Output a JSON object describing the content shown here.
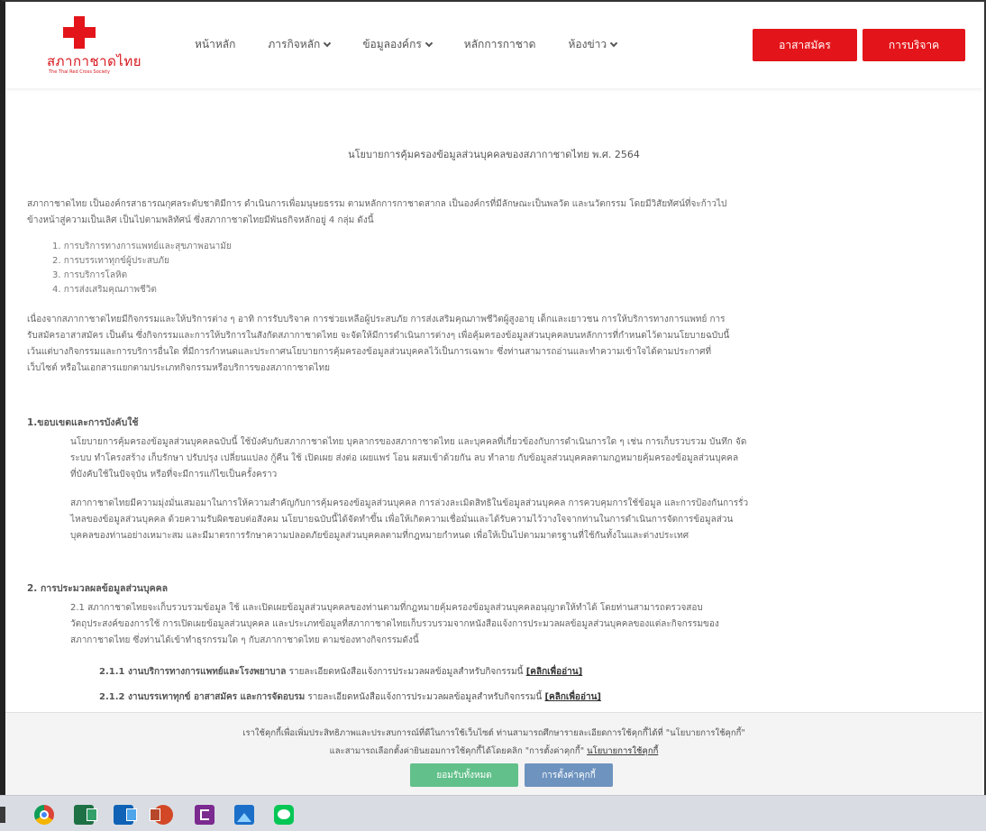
{
  "header": {
    "logo_thai": "สภากาชาดไทย",
    "logo_english": "The Thai Red Cross Society",
    "nav": [
      "หน้าหลัก",
      "ภารกิจหลัก",
      "ข้อมูลองค์กร",
      "หลักการกาชาด",
      "ห้องข่าว"
    ],
    "volunteer_button": "อาสาสมัคร",
    "donate_button": "การบริจาค"
  },
  "main": {
    "title": "นโยบายการคุ้มครองข้อมูลส่วนบุคคลของสภากาชาดไทย พ.ศ. 2564",
    "intro_lines": [
      "สภากาชาดไทย เป็นองค์กรสาธารณกุศลระดับชาติมีการ ดำเนินการเพื่อมนุษยธรรม ตามหลักการกาชาดสากล เป็นองค์กรที่มีลักษณะเป็นพลวัต และนวัตกรรม โดยมีวิสัยทัศน์ที่จะก้าวไป",
      "ข้างหน้าสู่ความเป็นเลิศ เป็นไปตามพลิทัศน์ ซึ่งสภากาชาดไทยมีพันธกิจหลักอยู่ 4 กลุ่ม ดังนี้"
    ],
    "missions": [
      "1. การบริการทางการแพทย์และสุขภาพอนามัย",
      "2. การบรรเทาทุกข์ผู้ประสบภัย",
      "3. การบริการโลหิต",
      "4. การส่งเสริมคุณภาพชีวิต"
    ],
    "para2_lines": [
      "เนื่องจากสภากาชาดไทยมีกิจกรรมและให้บริการต่าง ๆ อาทิ การรับบริจาค การช่วยเหลือผู้ประสบภัย การส่งเสริมคุณภาพชีวิตผู้สูงอายุ เด็กและเยาวชน การให้บริการทางการแพทย์ การ",
      "รับสมัครอาสาสมัคร เป็นต้น ซึ่งกิจกรรมและการให้บริการในสังกัดสภากาชาดไทย จะจัดให้มีการดำเนินการต่างๆ เพื่อคุ้มครองข้อมูลส่วนบุคคลบนหลักการที่กำหนดไว้ตามนโยบายฉบับนี้",
      "เว้นแต่บางกิจกรรมและการบริการอื่นใด ที่มีการกำหนดและประกาศนโยบายการคุ้มครองข้อมูลส่วนบุคคลไว้เป็นการเฉพาะ ซึ่งท่านสามารถอ่านและทำความเข้าใจได้ตามประกาศที่",
      "เว็บไซต์ หรือในเอกสารแยกตามประเภทกิจกรรมหรือบริการของสภากาชาดไทย"
    ],
    "section1_heading": "1.ขอบเขตและการบังคับใช้",
    "section1_p1_lines": [
      "นโยบายการคุ้มครองข้อมูลส่วนบุคคลฉบับนี้ ใช้บังคับกับสภากาชาดไทย บุคลากรของสภากาชาดไทย และบุคคลที่เกี่ยวข้องกับการดำเนินการใด ๆ เช่น การเก็บรวบรวม บันทึก จัด",
      "ระบบ ทำโครงสร้าง เก็บรักษา ปรับปรุง เปลี่ยนแปลง กู้คืน ใช้ เปิดเผย ส่งต่อ เผยแพร่ โอน ผสมเข้าด้วยกัน ลบ ทำลาย กับข้อมูลส่วนบุคคลตามกฎหมายคุ้มครองข้อมูลส่วนบุคคล",
      "ที่บังคับใช้ในปัจจุบัน หรือที่จะมีการแก้ไขเป็นครั้งคราว"
    ],
    "section1_p2_lines": [
      "สภากาชาดไทยมีความมุ่งมั่นเสมอมาในการให้ความสำคัญกับการคุ้มครองข้อมูลส่วนบุคคล การล่วงละเมิดสิทธิในข้อมูลส่วนบุคคล การควบคุมการใช้ข้อมูล และการป้องกันการรั่ว",
      "ไหลของข้อมูลส่วนบุคคล ด้วยความรับผิดชอบต่อสังคม นโยบายฉบับนี้ได้จัดทำขึ้น เพื่อให้เกิดความเชื่อมั่นและได้รับความไว้วางใจจากท่านในการดำเนินการจัดการข้อมูลส่วน",
      "บุคคลของท่านอย่างเหมาะสม และมีมาตรการรักษาความปลอดภัยข้อมูลส่วนบุคคลตามที่กฎหมายกำหนด เพื่อให้เป็นไปตามมาตรฐานที่ใช้กันทั้งในและต่างประเทศ"
    ],
    "section2_heading": "2. การประมวลผลข้อมูลส่วนบุคคล",
    "section2_p_lines": [
      "2.1 สภากาชาดไทยจะเก็บรวบรวมข้อมูล ใช้ และเปิดเผยข้อมูลส่วนบุคคลของท่านตามที่กฎหมายคุ้มครองข้อมูลส่วนบุคคลอนุญาตให้ทำได้ โดยท่านสามารถตรวจสอบ",
      "วัตถุประสงค์ของการใช้ การเปิดเผยข้อมูลส่วนบุคคล และประเภทข้อมูลที่สภากาชาดไทยเก็บรวบรวมจากหนังสือแจ้งการประมวลผลข้อมูลส่วนบุคคลของแต่ละกิจกรรมของ",
      "สภากาชาดไทย ซึ่งท่านได้เข้าทำธุรกรรมใด ๆ กับสภากาชาดไทย ตามช่องทางกิจกรรมดังนี้"
    ],
    "item_211_bold": "2.1.1 งานบริการทางการแพทย์และโรงพยาบาล",
    "item_211_text": " รายละเอียดหนังสือแจ้งการประมวลผลข้อมูลสำหรับกิจกรรมนี้ ",
    "item_211_link": "[คลิกเพื่ออ่าน]",
    "item_212_bold": "2.1.2 งานบรรเทาทุกข์ อาสาสมัคร และการจัดอบรม",
    "item_212_text": " รายละเอียดหนังสือแจ้งการประมวลผลข้อมูลสำหรับกิจกรรมนี้ ",
    "item_212_link": "[คลิกเพื่ออ่าน]"
  },
  "cookie": {
    "line1_text": "เราใช้คุกกี้เพื่อเพิ่มประสิทธิภาพและประสบการณ์ที่ดีในการใช้เว็บไซต์ ท่านสามารถศึกษารายละเอียดการใช้คุกกี้ได้ที่ \"นโยบายการใช้คุกกี้\"",
    "line2_text": "และสามารถเลือกตั้งค่ายินยอมการใช้คุกกี้ได้โดยคลิก \"การตั้งค่าคุกกี้\" ",
    "line2_link": "นโยบายการใช้คุกกี้",
    "accept_button": "ยอมรับทั้งหมด",
    "settings_button": "การตั้งค่าคุกกี้"
  },
  "taskbar": {
    "icons": [
      "chrome-icon",
      "excel-icon",
      "outlook-icon",
      "powerpoint-icon",
      "onenote-icon",
      "photos-icon",
      "line-icon"
    ]
  },
  "colors": {
    "brand_red": "#e3151a",
    "accept_green": "#62c08a",
    "settings_blue": "#6e93bf"
  }
}
